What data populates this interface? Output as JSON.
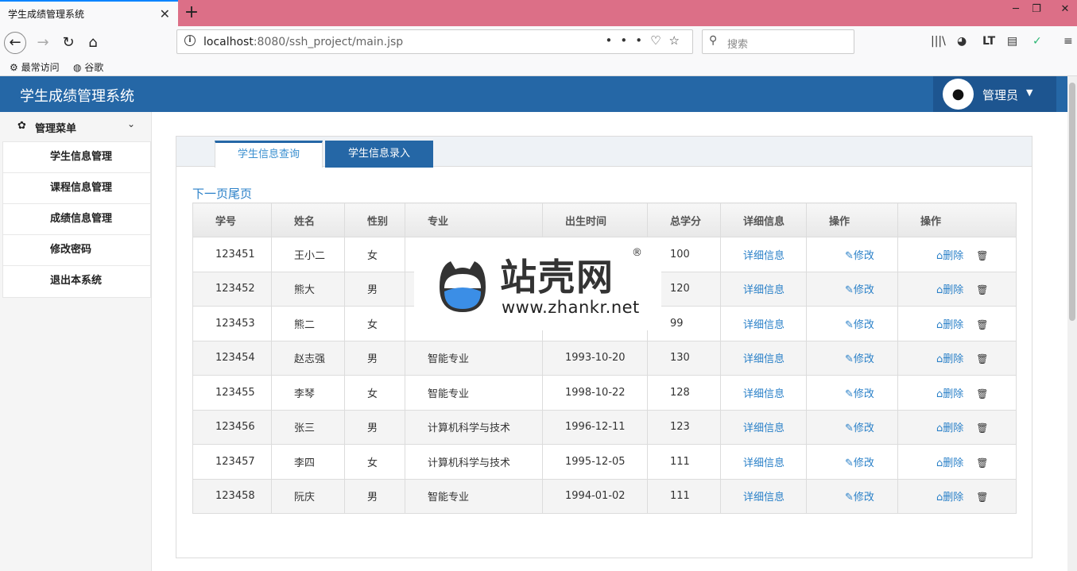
{
  "browser": {
    "tab_title": "学生成绩管理系统",
    "tab_close": "✕",
    "new_tab": "+",
    "url_host": "localhost",
    "url_rest": ":8080/ssh_project/main.jsp",
    "search_placeholder": "搜索",
    "bookmarks": [
      "最常访问",
      "谷歌"
    ]
  },
  "app": {
    "title": "学生成绩管理系统",
    "user": "管理员"
  },
  "sidebar": {
    "header": "管理菜单",
    "items": [
      {
        "label": "学生信息管理"
      },
      {
        "label": "课程信息管理"
      },
      {
        "label": "成绩信息管理"
      },
      {
        "label": "修改密码"
      },
      {
        "label": "退出本系统"
      }
    ]
  },
  "tabs": [
    {
      "label": "学生信息查询",
      "active": true
    },
    {
      "label": "学生信息录入",
      "active": false
    }
  ],
  "pager": {
    "next": "下一页",
    "last": "尾页"
  },
  "table": {
    "headers": [
      "学号",
      "姓名",
      "性别",
      "专业",
      "出生时间",
      "总学分",
      "详细信息",
      "操作",
      "操作"
    ],
    "detail_label": "详细信息",
    "edit_label": "修改",
    "delete_label": "删除",
    "rows": [
      {
        "id": "123451",
        "name": "王小二",
        "sex": "女",
        "major": "",
        "birth": "",
        "credits": "100"
      },
      {
        "id": "123452",
        "name": "熊大",
        "sex": "男",
        "major": "",
        "birth": "",
        "credits": "120"
      },
      {
        "id": "123453",
        "name": "熊二",
        "sex": "女",
        "major": "",
        "birth": "",
        "credits": "99"
      },
      {
        "id": "123454",
        "name": "赵志强",
        "sex": "男",
        "major": "智能专业",
        "birth": "1993-10-20",
        "credits": "130"
      },
      {
        "id": "123455",
        "name": "李琴",
        "sex": "女",
        "major": "智能专业",
        "birth": "1998-10-22",
        "credits": "128"
      },
      {
        "id": "123456",
        "name": "张三",
        "sex": "男",
        "major": "计算机科学与技术",
        "birth": "1996-12-11",
        "credits": "123"
      },
      {
        "id": "123457",
        "name": "李四",
        "sex": "女",
        "major": "计算机科学与技术",
        "birth": "1995-12-05",
        "credits": "111"
      },
      {
        "id": "123458",
        "name": "阮庆",
        "sex": "男",
        "major": "智能专业",
        "birth": "1994-01-02",
        "credits": "111"
      }
    ]
  },
  "watermark": {
    "cn": "站壳网",
    "url": "www.zhankr.net",
    "reg": "®"
  },
  "colors": {
    "header_blue": "#2567a6",
    "link_blue": "#2a80c8",
    "tabbar_pink": "#dc6f87"
  }
}
